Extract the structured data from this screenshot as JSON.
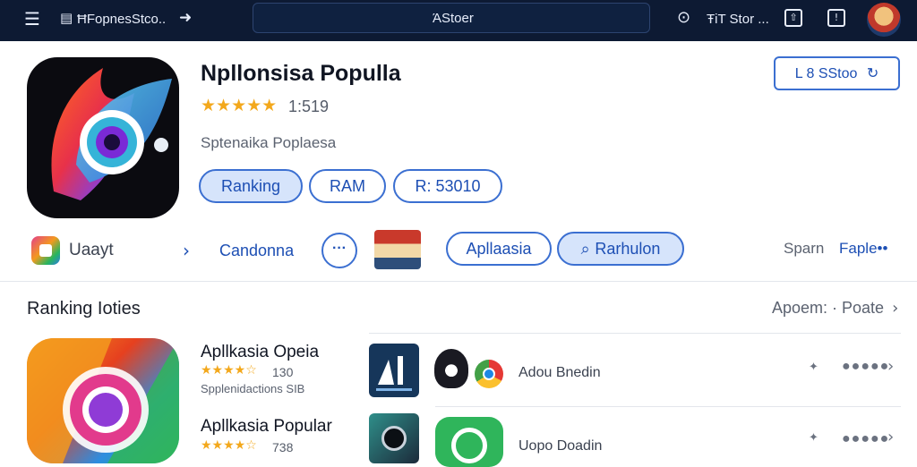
{
  "topbar": {
    "app_label": "ĦFopnesStco..",
    "search_text": "ΆStoer",
    "store_text": "ŦiT Stor ..."
  },
  "app": {
    "title": "Npllonsisa Populla",
    "rating_stars": "★★★★★",
    "rating_value": "1:519",
    "subtitle": "Sptenaika Poplaesa",
    "store_button": "L 8 SStoo",
    "pills": [
      "Ranking",
      "RAM",
      "R: 53010"
    ]
  },
  "row2": {
    "label": "Uaayt",
    "link": "Candonna",
    "pills": [
      "Apllaasia",
      "Rarhulon"
    ],
    "right_text": "Sparn",
    "right_link": "Faple••"
  },
  "section": {
    "title": "Ranking Ioties",
    "link": "Apoem: · Poate"
  },
  "list": [
    {
      "title": "Apllkasia Opeia",
      "stars": "★★★★☆",
      "count": "130",
      "sub": "Spplenidactions SIB",
      "label": "Adou Bnedin"
    },
    {
      "title": "Apllkasia Popular",
      "stars": "★★★★☆",
      "count": "738",
      "sub": "",
      "label": "Uopo Doadin"
    }
  ],
  "colors": {
    "topbar": "#0d1a33",
    "accent": "#3b6fd1",
    "star": "#f3a81c"
  },
  "icons": [
    "menu-icon",
    "bag-icon",
    "arrow-right-icon",
    "search-icon",
    "clock-icon",
    "share-icon",
    "box-icon",
    "avatar",
    "chevron-right-icon",
    "more-icon",
    "chat-icon"
  ]
}
